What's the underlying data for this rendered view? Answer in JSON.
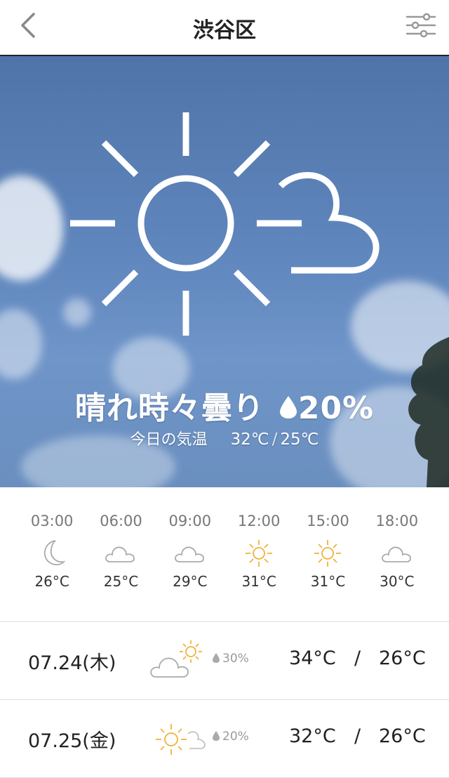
{
  "header": {
    "title": "渋谷区",
    "back_icon": "chevron-left-icon",
    "settings_icon": "sliders-icon"
  },
  "hero": {
    "icon": "sun-cloud-icon",
    "condition": "晴れ時々曇り",
    "rain_chance": "20%",
    "today_label": "今日の気温",
    "high": "32℃",
    "low": "25℃"
  },
  "hourly": [
    {
      "time": "03:00",
      "icon": "moon-icon",
      "temp": "26°C"
    },
    {
      "time": "06:00",
      "icon": "cloud-icon",
      "temp": "25°C"
    },
    {
      "time": "09:00",
      "icon": "cloud-icon",
      "temp": "29°C"
    },
    {
      "time": "12:00",
      "icon": "sun-icon",
      "temp": "31°C"
    },
    {
      "time": "15:00",
      "icon": "sun-icon",
      "temp": "31°C"
    },
    {
      "time": "18:00",
      "icon": "cloud-icon",
      "temp": "30°C"
    }
  ],
  "daily": [
    {
      "date": "07.24(木)",
      "icon": "cloud-sun-icon",
      "rain": "30%",
      "high": "34°C",
      "sep": "/",
      "low": "26°C"
    },
    {
      "date": "07.25(金)",
      "icon": "sun-cloud-icon",
      "rain": "20%",
      "high": "32°C",
      "sep": "/",
      "low": "26°C"
    }
  ],
  "colors": {
    "sun_accent": "#f0b23a",
    "icon_gray": "#9a9a9a",
    "sky": "#5f86bd"
  }
}
